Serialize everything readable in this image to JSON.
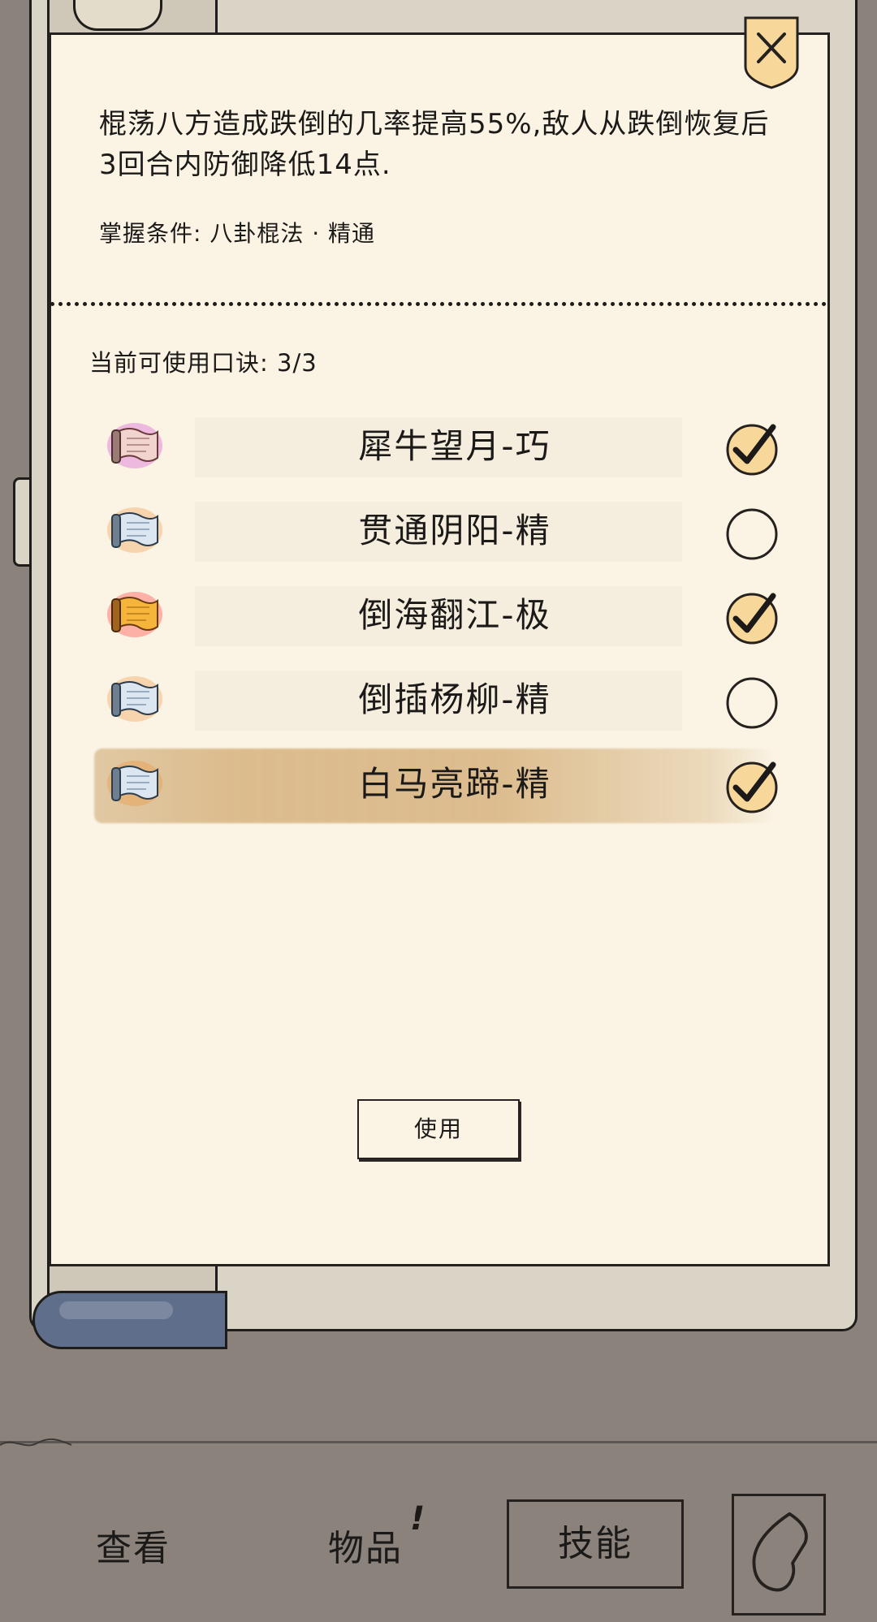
{
  "description": "棍荡八方造成跌倒的几率提高55%,敌人从跌倒恢复后3回合内防御降低14点.",
  "condition": "掌握条件: 八卦棍法 · 精通",
  "usage": "当前可使用口诀: 3/3",
  "skills": [
    {
      "name": "犀牛望月-巧",
      "checked": true,
      "scroll": "pink-scroll-icon",
      "glow": "#d84ad0"
    },
    {
      "name": "贯通阴阳-精",
      "checked": false,
      "scroll": "blue-scroll-icon",
      "glow": "#f08a2a"
    },
    {
      "name": "倒海翻江-极",
      "checked": true,
      "scroll": "gold-scroll-icon",
      "glow": "#ff3030"
    },
    {
      "name": "倒插杨柳-精",
      "checked": false,
      "scroll": "blue-scroll-icon",
      "glow": "#f08a2a"
    },
    {
      "name": "白马亮蹄-精",
      "checked": true,
      "scroll": "blue-scroll-icon",
      "glow": "#f08a2a",
      "selected": true
    }
  ],
  "use_button": "使用",
  "nav": {
    "view": "查看",
    "items": "物品",
    "items_alert": "!",
    "skills": "技能"
  },
  "colors": {
    "paper": "#fbf4e5",
    "background": "#8a827b",
    "check_fill": "#f7d89a",
    "selected_row": "#d9b786"
  }
}
